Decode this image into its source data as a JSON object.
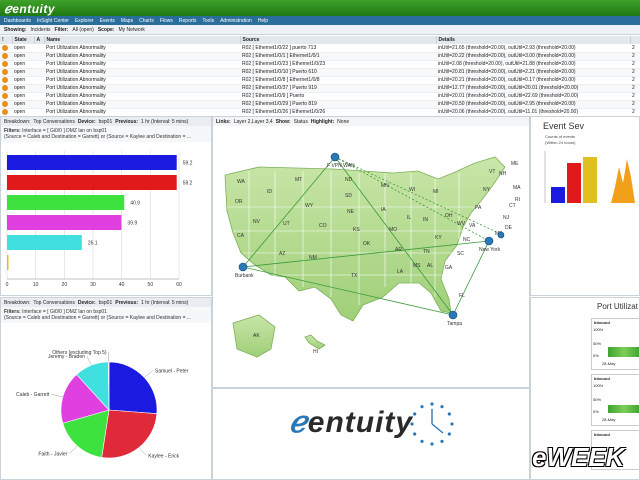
{
  "app": {
    "logo": "entuity"
  },
  "nav": [
    "Dashboards",
    "InSight Center",
    "Explorer",
    "Events",
    "Maps",
    "Charts",
    "Flows",
    "Reports",
    "Tools",
    "Administration",
    "Help"
  ],
  "filterbar": {
    "showing_label": "Showing:",
    "showing_value": "Incidents",
    "filter_label": "Filter:",
    "filter_value": "All (open)",
    "scope_label": "Scope:",
    "scope_value": "My Network"
  },
  "incidents": {
    "columns": [
      "!",
      "State",
      "A",
      "Name",
      "Source",
      "Details"
    ],
    "rows": [
      {
        "state": "open",
        "name": "Port Utilization Abnormality",
        "source": "R02 [ Ethernet1/0/22 ] puerto 713",
        "details": "inUtil=21.65 (threshold=20.00), outUtil=2.93 (threshold=20.00)",
        "count": "2"
      },
      {
        "state": "open",
        "name": "Port Utilization Abnormality",
        "source": "R02 [ Ethernet1/0/1 ] Ethernet1/0/1",
        "details": "inUtil=20.22 (threshold=20.00), outUtil=3.00 (threshold=20.00)",
        "count": "2"
      },
      {
        "state": "open",
        "name": "Port Utilization Abnormality",
        "source": "R02 [ Ethernet1/0/23 ] Ethernet1/0/23",
        "details": "inUtil=2.08 (threshold=20.00), outUtil=21.88 (threshold=20.00)",
        "count": "2"
      },
      {
        "state": "open",
        "name": "Port Utilization Abnormality",
        "source": "R02 [ Ethernet1/0/10 ] Puerto 610",
        "details": "inUtil=20.81 (threshold=20.00), outUtil=2.21 (threshold=20.00)",
        "count": "2"
      },
      {
        "state": "open",
        "name": "Port Utilization Abnormality",
        "source": "R02 [ Ethernet1/0/8 ] Ethernet1/0/8",
        "details": "inUtil=20.21 (threshold=20.00), outUtil=0.17 (threshold=20.00)",
        "count": "2"
      },
      {
        "state": "open",
        "name": "Port Utilization Abnormality",
        "source": "R02 [ Ethernet1/0/37 ] Puerto 919",
        "details": "inUtil=12.77 (threshold=20.00), outUtil=20.01 (threshold=20.00)",
        "count": "2"
      },
      {
        "state": "open",
        "name": "Port Utilization Abnormality",
        "source": "R02 [ Ethernet1/0/9 ] Puerto",
        "details": "inUtil=20.01 (threshold=20.00), outUtil=22.69 (threshold=20.00)",
        "count": "2"
      },
      {
        "state": "open",
        "name": "Port Utilization Abnormality",
        "source": "R02 [ Ethernet1/0/29 ] Puerto 819",
        "details": "inUtil=20.50 (threshold=20.00), outUtil=2.95 (threshold=20.00)",
        "count": "2"
      },
      {
        "state": "open",
        "name": "Port Utilization Abnormality",
        "source": "R02 [ Ethernet1/0/26 ] Ethernet1/0/26",
        "details": "inUtil=20.06 (threshold=20.00), outUtil=11.01 (threshold=20.00)",
        "count": "2"
      }
    ]
  },
  "bar_panel": {
    "breakdown_label": "Breakdown:",
    "breakdown_value": "Top Conversations",
    "device_label": "Device:",
    "device_value": "bsp01",
    "previous_label": "Previous:",
    "previous_value": "1 hr (Interval: 5 mins)",
    "filters_label": "Filters:",
    "filters_line1": "Interface = [ Gi0/0 ] DMZ lan on bsp01",
    "filters_line2": "(Source = Caleb and Destination = Garrett) or (Source = Kaylee and Destination = ..."
  },
  "pie_panel": {
    "breakdown_label": "Breakdown:",
    "breakdown_value": "Top Conversations",
    "device_label": "Device:",
    "device_value": "bsp01",
    "previous_label": "Previous:",
    "previous_value": "1 hr (Interval: 5 mins)",
    "filters_label": "Filters:",
    "filters_line1": "Interface = [ Gi0/0 ] DMZ lan on bsp01",
    "filters_line2": "(Source = Caleb and Destination = Garrett) or (Source = Kaylee and Destination = ..."
  },
  "map_panel": {
    "links_label": "Links:",
    "links_value": "Layer 2,Layer 3,4",
    "show_label": "Show:",
    "show_value": "Status",
    "highlight_label": "Highlight:",
    "highlight_value": "None",
    "state_labels": [
      {
        "t": "WA"
      },
      {
        "t": "OR"
      },
      {
        "t": "CA"
      },
      {
        "t": "NV"
      },
      {
        "t": "ID"
      },
      {
        "t": "MT"
      },
      {
        "t": "WY"
      },
      {
        "t": "UT"
      },
      {
        "t": "AZ"
      },
      {
        "t": "CO"
      },
      {
        "t": "NM"
      },
      {
        "t": "ND"
      },
      {
        "t": "SD"
      },
      {
        "t": "NE"
      },
      {
        "t": "KS"
      },
      {
        "t": "OK"
      },
      {
        "t": "TX"
      },
      {
        "t": "MN"
      },
      {
        "t": "IA"
      },
      {
        "t": "MO"
      },
      {
        "t": "AR"
      },
      {
        "t": "LA"
      },
      {
        "t": "WI"
      },
      {
        "t": "IL"
      },
      {
        "t": "MI"
      },
      {
        "t": "IN"
      },
      {
        "t": "OH"
      },
      {
        "t": "KY"
      },
      {
        "t": "TN"
      },
      {
        "t": "MS"
      },
      {
        "t": "AL"
      },
      {
        "t": "GA"
      },
      {
        "t": "FL"
      },
      {
        "t": "SC"
      },
      {
        "t": "NC"
      },
      {
        "t": "VA"
      },
      {
        "t": "WV"
      },
      {
        "t": "PA"
      },
      {
        "t": "NY"
      },
      {
        "t": "VT"
      },
      {
        "t": "NH"
      },
      {
        "t": "ME"
      },
      {
        "t": "MA"
      },
      {
        "t": "RI"
      },
      {
        "t": "CT"
      },
      {
        "t": "NJ"
      },
      {
        "t": "DE"
      },
      {
        "t": "MD"
      },
      {
        "t": "AK"
      },
      {
        "t": "HI"
      }
    ],
    "node_labels": [
      "F VPN WAN",
      "Burbank",
      "New York",
      "Tampa"
    ]
  },
  "event_sev": {
    "title": "Event Sev",
    "sub1": "Counts of events",
    "sub2": "(Within 24 hours)"
  },
  "port_util": {
    "title": "Port Utilizat",
    "inbound_label": "Inbound",
    "y100": "100%",
    "y50": "50%",
    "y0": "0%",
    "date": "28-May"
  },
  "watermark": "eWEEK",
  "chart_data": [
    {
      "type": "bar",
      "orientation": "horizontal",
      "categories": [
        "bar-1",
        "bar-2",
        "bar-3",
        "bar-4",
        "bar-5",
        "bar-6"
      ],
      "values": [
        59.2,
        59.2,
        40.9,
        39.9,
        26.1,
        0
      ],
      "colors": [
        "#1a1ae0",
        "#e01a1a",
        "#3ee23e",
        "#e040e0",
        "#40e0e0",
        "#e0c020"
      ],
      "value_labels": [
        "59.2",
        "59.2",
        "40.9",
        "39.9",
        "26.1",
        ""
      ],
      "xlim": [
        0,
        60
      ],
      "xticks": [
        "0",
        "10",
        "20",
        "30",
        "40",
        "50",
        "60"
      ],
      "grid": true
    },
    {
      "type": "pie",
      "labels": [
        "Samuel - Peter",
        "Kaylee - Erick",
        "Faith - Javier",
        "Caleb - Garrett",
        "Jeremy - Braden",
        "Others (excluding Top 5)"
      ],
      "values": [
        59.2,
        59.2,
        40.9,
        39.9,
        26.1,
        0.5
      ],
      "colors": [
        "#1a1ae0",
        "#e02a3a",
        "#3ee23e",
        "#e040e0",
        "#40e0e0",
        "#e0c020"
      ]
    }
  ]
}
